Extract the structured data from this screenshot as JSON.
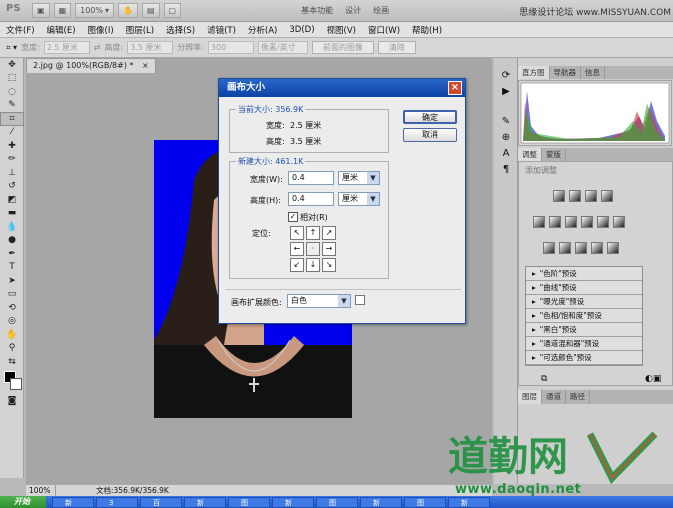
{
  "title_bar": {
    "logo": "PS",
    "zoom": "100%",
    "workspaces": [
      "基本功能",
      "设计",
      "绘画"
    ],
    "watermark_site": "思缘设计论坛 www.MISSYUAN.COM"
  },
  "menu": [
    "文件(F)",
    "编辑(E)",
    "图像(I)",
    "图层(L)",
    "选择(S)",
    "滤镜(T)",
    "分析(A)",
    "3D(D)",
    "视图(V)",
    "窗口(W)",
    "帮助(H)"
  ],
  "options_bar": {
    "width_label": "宽度:",
    "width_value": "2.5 厘米",
    "height_label": "高度:",
    "height_value": "3.5 厘米",
    "resolution_label": "分辨率:",
    "resolution_value": "300",
    "unit": "像素/英寸",
    "front_image_button": "前面的图像",
    "clear_button": "清除"
  },
  "document": {
    "tab_label": "2.jpg @ 100%(RGB/8#) *",
    "zoom": "100%",
    "doc_info": "文档:356.9K/356.9K"
  },
  "panels": {
    "top_tabs": [
      "直方图",
      "导航器",
      "信息"
    ],
    "adjust_tabs": [
      "调整",
      "蒙版"
    ],
    "adjust_title": "添加调整",
    "presets": [
      "\"色阶\"预设",
      "\"曲线\"预设",
      "\"曝光度\"预设",
      "\"色相/饱和度\"预设",
      "\"黑白\"预设",
      "\"通道混和器\"预设",
      "\"可选颜色\"预设"
    ],
    "layer_tabs": [
      "图层",
      "通道",
      "路径"
    ]
  },
  "dialog": {
    "title": "画布大小",
    "current_group": "当前大小: 356.9K",
    "current_width_label": "宽度:",
    "current_width": "2.5 厘米",
    "current_height_label": "高度:",
    "current_height": "3.5 厘米",
    "new_group": "新建大小: 461.1K",
    "width_label": "宽度(W):",
    "width_value": "0.4",
    "height_label": "高度(H):",
    "height_value": "0.4",
    "unit": "厘米",
    "relative_label": "相对(R)",
    "relative_checked": true,
    "anchor_label": "定位:",
    "ext_color_label": "画布扩展颜色:",
    "ext_color_value": "白色",
    "ok_button": "确定",
    "cancel_button": "取消"
  },
  "taskbar": {
    "start": "开始",
    "tasks": [
      "新",
      "3",
      "百",
      "新",
      "图",
      "新",
      "图",
      "新",
      "图",
      "新"
    ]
  },
  "watermark": {
    "logo_text": "道勤网",
    "url": "www.daoqin.net"
  },
  "colors": {
    "canvas_blue": "#0000ee",
    "dialog_title": "#1a55bb",
    "watermark_green": "#1f8f3f"
  }
}
